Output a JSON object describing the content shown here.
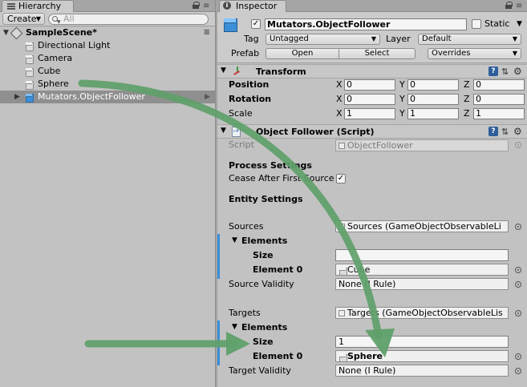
{
  "hierarchy": {
    "tab_title": "Hierarchy",
    "create_label": "Create",
    "search_placeholder": "All",
    "scene_name": "SampleScene*",
    "items": [
      {
        "label": "Directional Light"
      },
      {
        "label": "Camera"
      },
      {
        "label": "Cube"
      },
      {
        "label": "Sphere"
      },
      {
        "label": "Mutators.ObjectFollower"
      }
    ]
  },
  "inspector": {
    "tab_title": "Inspector",
    "object_name": "Mutators.ObjectFollower",
    "static_label": "Static",
    "tag_label": "Tag",
    "tag_value": "Untagged",
    "layer_label": "Layer",
    "layer_value": "Default",
    "prefab_label": "Prefab",
    "open_label": "Open",
    "select_label": "Select",
    "overrides_label": "Overrides",
    "transform": {
      "title": "Transform",
      "position_label": "Position",
      "rotation_label": "Rotation",
      "scale_label": "Scale",
      "position": {
        "x": "0",
        "y": "0",
        "z": "0"
      },
      "rotation": {
        "x": "0",
        "y": "0",
        "z": "0"
      },
      "scale": {
        "x": "1",
        "y": "1",
        "z": "1"
      },
      "axis_x": "X",
      "axis_y": "Y",
      "axis_z": "Z"
    },
    "follower": {
      "title": "Object Follower (Script)",
      "script_label": "Script",
      "script_value": "ObjectFollower",
      "process_settings": "Process Settings",
      "cease_label": "Cease After First Source",
      "entity_settings": "Entity Settings",
      "sources_label": "Sources",
      "sources_value": "Sources (GameObjectObservableLi",
      "elements_label": "Elements",
      "size_label": "Size",
      "sources_size": "",
      "element0_label": "Element 0",
      "sources_element0": "Cube",
      "source_validity_label": "Source Validity",
      "source_validity_value": "None (I Rule)",
      "targets_label": "Targets",
      "targets_value": "Targets (GameObjectObservableLis",
      "targets_size": "1",
      "targets_element0": "Sphere",
      "target_validity_label": "Target Validity",
      "target_validity_value": "None (I Rule)"
    }
  },
  "colors": {
    "arrow": "#5fa06a",
    "selection": "#8f8f8f",
    "panel": "#c2c2c2"
  }
}
